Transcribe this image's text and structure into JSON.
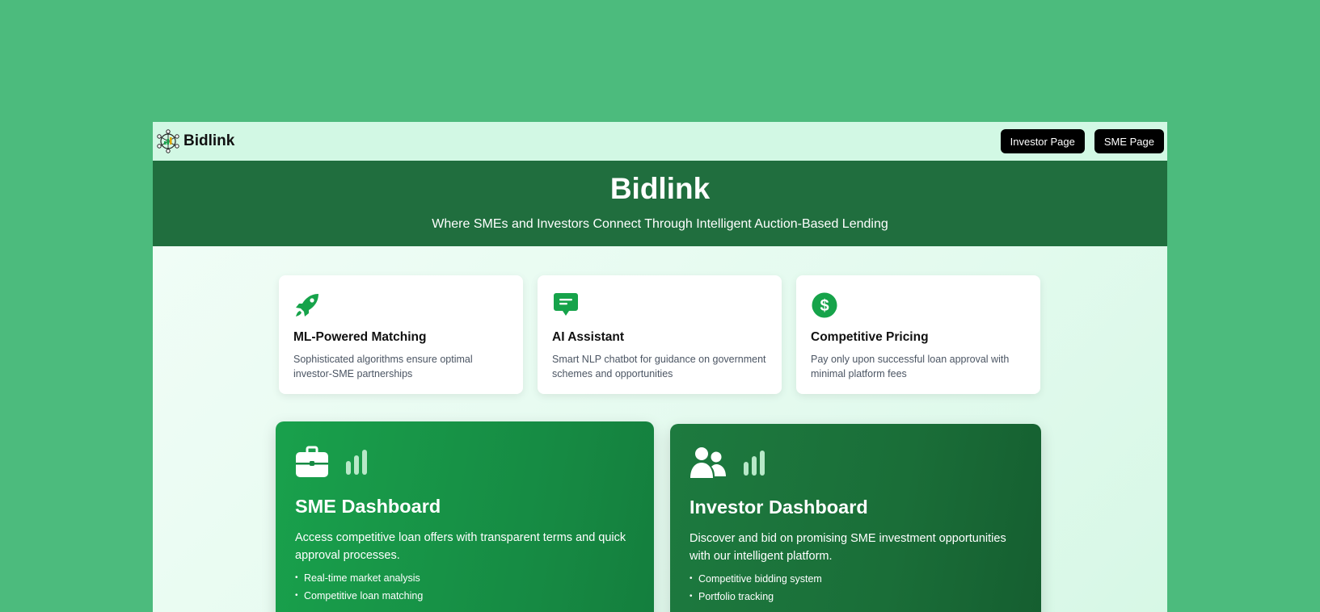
{
  "navbar": {
    "brand_name": "Bidlink",
    "investor_button": "Investor Page",
    "sme_button": "SME Page"
  },
  "hero": {
    "title": "Bidlink",
    "subtitle": "Where SMEs and Investors Connect Through Intelligent Auction-Based Lending"
  },
  "features": [
    {
      "icon": "rocket-icon",
      "title": "ML-Powered Matching",
      "desc": "Sophisticated algorithms ensure optimal investor-SME partnerships"
    },
    {
      "icon": "chat-icon",
      "title": "AI Assistant",
      "desc": "Smart NLP chatbot for guidance on government schemes and opportunities"
    },
    {
      "icon": "dollar-icon",
      "title": "Competitive Pricing",
      "desc": "Pay only upon successful loan approval with minimal platform fees"
    }
  ],
  "sme_dashboard": {
    "icons": [
      "briefcase-icon",
      "signal-bars-icon"
    ],
    "title": "SME Dashboard",
    "desc": "Access competitive loan offers with transparent terms and quick approval processes.",
    "items": [
      "Real-time market analysis",
      "Competitive loan matching"
    ]
  },
  "investor_dashboard": {
    "icons": [
      "users-icon",
      "signal-bars-icon"
    ],
    "title": "Investor Dashboard",
    "desc": "Discover and bid on promising SME investment opportunities with our intelligent platform.",
    "items": [
      "Competitive bidding system",
      "Portfolio tracking"
    ]
  },
  "colors": {
    "page_background": "#4cbb7d",
    "navbar": "#d2f8e4",
    "hero": "#206e3e",
    "accent": "#16a34a",
    "button": "#000000"
  }
}
